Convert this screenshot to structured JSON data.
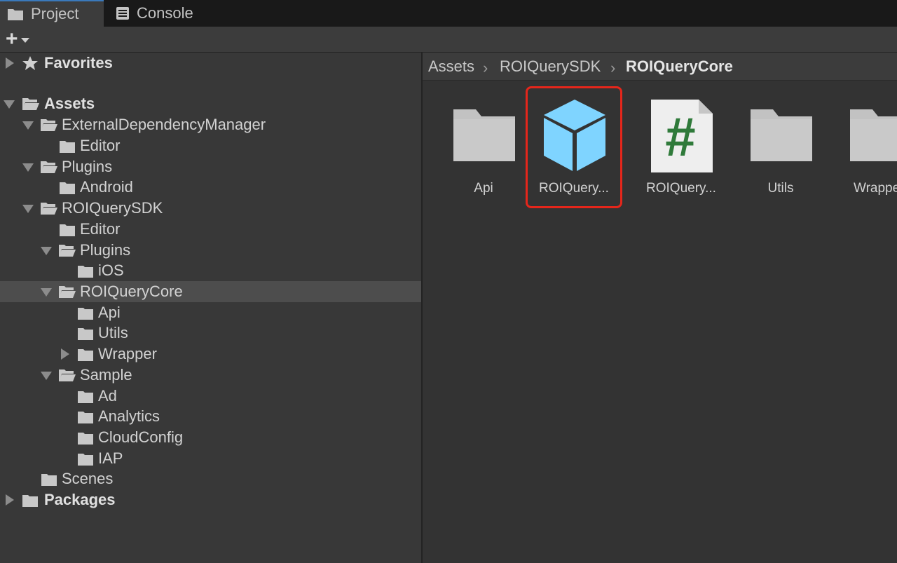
{
  "tabs": [
    {
      "label": "Project",
      "icon": "folder-icon"
    },
    {
      "label": "Console",
      "icon": "console-icon"
    }
  ],
  "toolbar": {
    "add_label": "+"
  },
  "tree": {
    "favorites": "Favorites",
    "assets": "Assets",
    "external_dependency_manager": "ExternalDependencyManager",
    "edm_editor": "Editor",
    "plugins": "Plugins",
    "plugins_android": "Android",
    "roiquery_sdk": "ROIQuerySDK",
    "sdk_editor": "Editor",
    "sdk_plugins": "Plugins",
    "sdk_plugins_ios": "iOS",
    "roiquery_core": "ROIQueryCore",
    "core_api": "Api",
    "core_utils": "Utils",
    "core_wrapper": "Wrapper",
    "sample": "Sample",
    "sample_ad": "Ad",
    "sample_analytics": "Analytics",
    "sample_cloudconfig": "CloudConfig",
    "sample_iap": "IAP",
    "scenes": "Scenes",
    "packages": "Packages"
  },
  "breadcrumb": {
    "assets": "Assets",
    "sdk": "ROIQuerySDK",
    "core": "ROIQueryCore"
  },
  "assets_grid": [
    {
      "name": "Api",
      "icon": "folder-icon"
    },
    {
      "name": "ROIQuery...",
      "icon": "prefab-cube-icon"
    },
    {
      "name": "ROIQuery...",
      "icon": "csharp-script-icon"
    },
    {
      "name": "Utils",
      "icon": "folder-icon"
    },
    {
      "name": "Wrappe",
      "icon": "folder-icon"
    }
  ],
  "colors": {
    "accent_tab": "#3a79bb",
    "highlight": "#e5261b",
    "prefab": "#7fd4ff",
    "script_hash": "#2f7a3a"
  }
}
